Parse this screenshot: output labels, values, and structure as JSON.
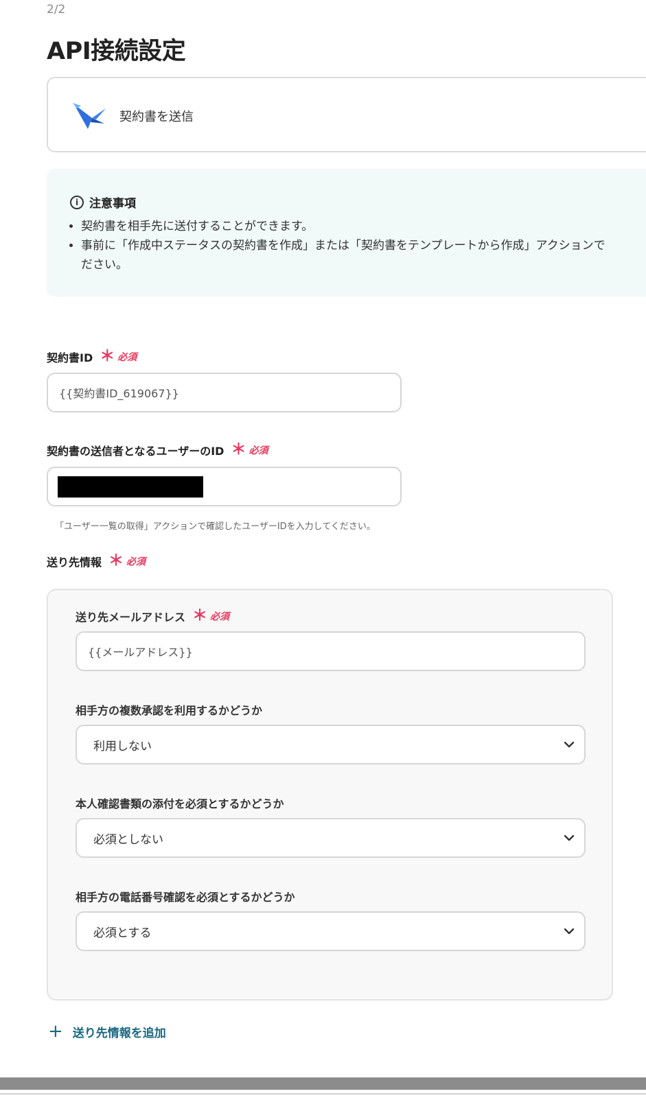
{
  "header": {
    "step": "2/2",
    "title": "API接続設定"
  },
  "action": {
    "label": "契約書を送信",
    "icon": "paper-plane-bird-icon",
    "icon_color": "#3b82e8"
  },
  "notice": {
    "title": "注意事項",
    "items": [
      "契約書を相手先に送付することができます。",
      "事前に「作成中ステータスの契約書を作成」または「契約書をテンプレートから作成」アクションで\nださい。"
    ]
  },
  "required": {
    "star": "＊",
    "text": "必須",
    "color": "#e8385e"
  },
  "fields": {
    "contract_id": {
      "label": "契約書ID",
      "value": "{{契約書ID_619067}}"
    },
    "sender_user_id": {
      "label": "契約書の送信者となるユーザーのID",
      "value": "",
      "hint": "「ユーザー一覧の取得」アクションで確認したユーザーIDを入力してください。"
    },
    "recipient": {
      "label": "送り先情報",
      "email": {
        "label": "送り先メールアドレス",
        "value": "{{メールアドレス}}"
      },
      "multi_approval": {
        "label": "相手方の複数承認を利用するかどうか",
        "selected": "利用しない"
      },
      "id_document": {
        "label": "本人確認書類の添付を必須とするかどうか",
        "selected": "必須としない"
      },
      "phone_verification": {
        "label": "相手方の電話番号確認を必須とするかどうか",
        "selected": "必須とする"
      }
    }
  },
  "add_recipient": {
    "label": "送り先情報を追加",
    "icon": "plus-icon",
    "color": "#1a6880"
  }
}
